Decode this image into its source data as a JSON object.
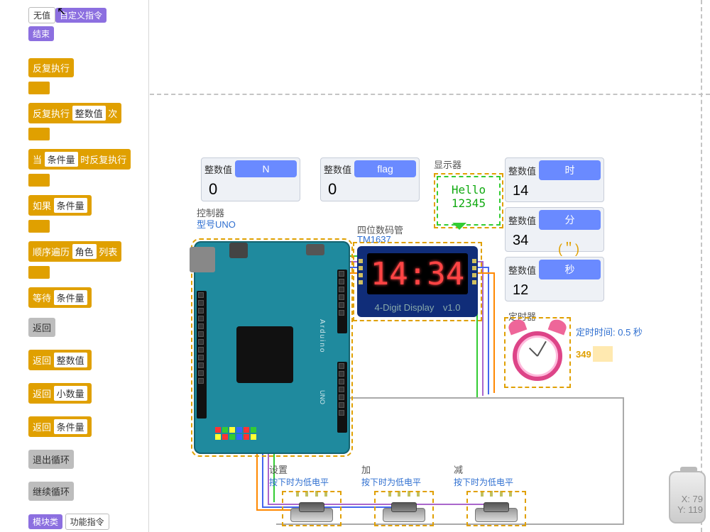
{
  "sidebar": {
    "top_row": {
      "novalue": "无值",
      "custom": "自定义指令"
    },
    "end": "结束",
    "blocks": [
      {
        "label": "反复执行"
      },
      {
        "label_pre": "反复执行",
        "slot": "整数值",
        "label_post": "次"
      },
      {
        "label_pre": "当",
        "slot": "条件量",
        "label_post": "时反复执行"
      },
      {
        "label_pre": "如果",
        "slot": "条件量"
      },
      {
        "label_pre": "顺序遍历",
        "slot": "角色",
        "label_post": "列表"
      },
      {
        "label_pre": "等待",
        "slot": "条件量"
      }
    ],
    "returns": [
      {
        "label": "返回"
      },
      {
        "label": "返回",
        "slot": "整数值"
      },
      {
        "label": "返回",
        "slot": "小数量"
      },
      {
        "label": "返回",
        "slot": "条件量"
      }
    ],
    "exit_loop": "退出循环",
    "continue_loop": "继续循环",
    "footer": {
      "module": "模块类",
      "func": "功能指令"
    }
  },
  "stage": {
    "var_N": {
      "type": "整数值",
      "name": "N",
      "value": "0"
    },
    "var_flag": {
      "type": "整数值",
      "name": "flag",
      "value": "0"
    },
    "display_hdr": "显示器",
    "display_lines": [
      "Hello",
      "12345"
    ],
    "var_hour": {
      "type": "整数值",
      "name": "时",
      "value": "14"
    },
    "var_min": {
      "type": "整数值",
      "name": "分",
      "value": "34"
    },
    "var_sec": {
      "type": "整数值",
      "name": "秒",
      "value": "12"
    },
    "quote": "(＂)",
    "controller_hdr": "控制器",
    "controller_model": "型号UNO",
    "seg_hdr": "四位数码管",
    "seg_model": "TM1637",
    "seg_digits": "14:34",
    "seg_footer_l": "4-Digit Display",
    "seg_footer_r": "v1.0",
    "timer_hdr": "定时器",
    "timer_interval": "定时时间: 0.5 秒",
    "timer_count": "349",
    "btn_set": {
      "title": "设置",
      "sub": "按下时为低电平"
    },
    "btn_add": {
      "title": "加",
      "sub": "按下时为低电平"
    },
    "btn_minus": {
      "title": "减",
      "sub": "按下时为低电平"
    },
    "brand": "Arduino",
    "brand2": "UNO",
    "coords": {
      "x": "X: 79",
      "y": "Y: 119"
    }
  }
}
